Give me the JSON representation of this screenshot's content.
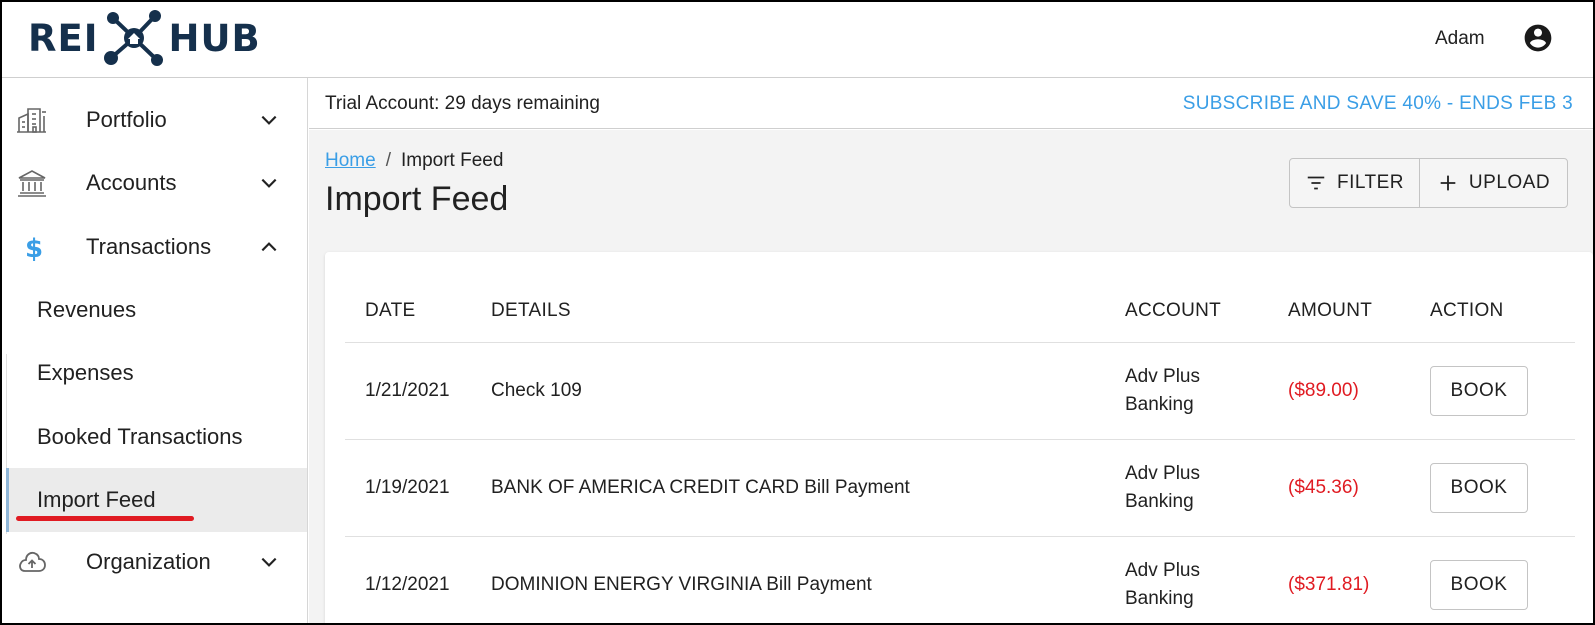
{
  "header": {
    "logo_left": "REI",
    "logo_right": "HUB",
    "user_name": "Adam"
  },
  "sidebar": {
    "items": [
      {
        "label": "Portfolio",
        "icon": "building-icon",
        "expanded": false
      },
      {
        "label": "Accounts",
        "icon": "bank-icon",
        "expanded": false
      },
      {
        "label": "Transactions",
        "icon": "dollar-icon",
        "expanded": true
      },
      {
        "label": "Organization",
        "icon": "cloud-upload-icon",
        "expanded": false
      }
    ],
    "subitems": [
      {
        "label": "Revenues",
        "active": false
      },
      {
        "label": "Expenses",
        "active": false
      },
      {
        "label": "Booked Transactions",
        "active": false
      },
      {
        "label": "Import Feed",
        "active": true
      }
    ]
  },
  "trial": {
    "text": "Trial Account: 29 days remaining",
    "subscribe": "SUBSCRIBE AND SAVE 40% - ENDS FEB 3"
  },
  "breadcrumb": {
    "home": "Home",
    "separator": "/",
    "current": "Import Feed"
  },
  "page": {
    "title": "Import Feed"
  },
  "toolbar": {
    "filter_label": "FILTER",
    "upload_label": "UPLOAD"
  },
  "table": {
    "columns": [
      "DATE",
      "DETAILS",
      "ACCOUNT",
      "AMOUNT",
      "ACTION"
    ],
    "rows": [
      {
        "date": "1/21/2021",
        "details": "Check 109",
        "account_line1": "Adv Plus",
        "account_line2": "Banking",
        "amount": "($89.00)",
        "action": "BOOK"
      },
      {
        "date": "1/19/2021",
        "details": "BANK OF AMERICA CREDIT CARD Bill Payment",
        "account_line1": "Adv Plus",
        "account_line2": "Banking",
        "amount": "($45.36)",
        "action": "BOOK"
      },
      {
        "date": "1/12/2021",
        "details": "DOMINION ENERGY VIRGINIA Bill Payment",
        "account_line1": "Adv Plus",
        "account_line2": "Banking",
        "amount": "($371.81)",
        "action": "BOOK"
      }
    ]
  },
  "colors": {
    "brand_navy": "#15304c",
    "link_blue": "#3a9ee6",
    "negative_red": "#e01b22",
    "highlight_underline": "#e01b22"
  }
}
